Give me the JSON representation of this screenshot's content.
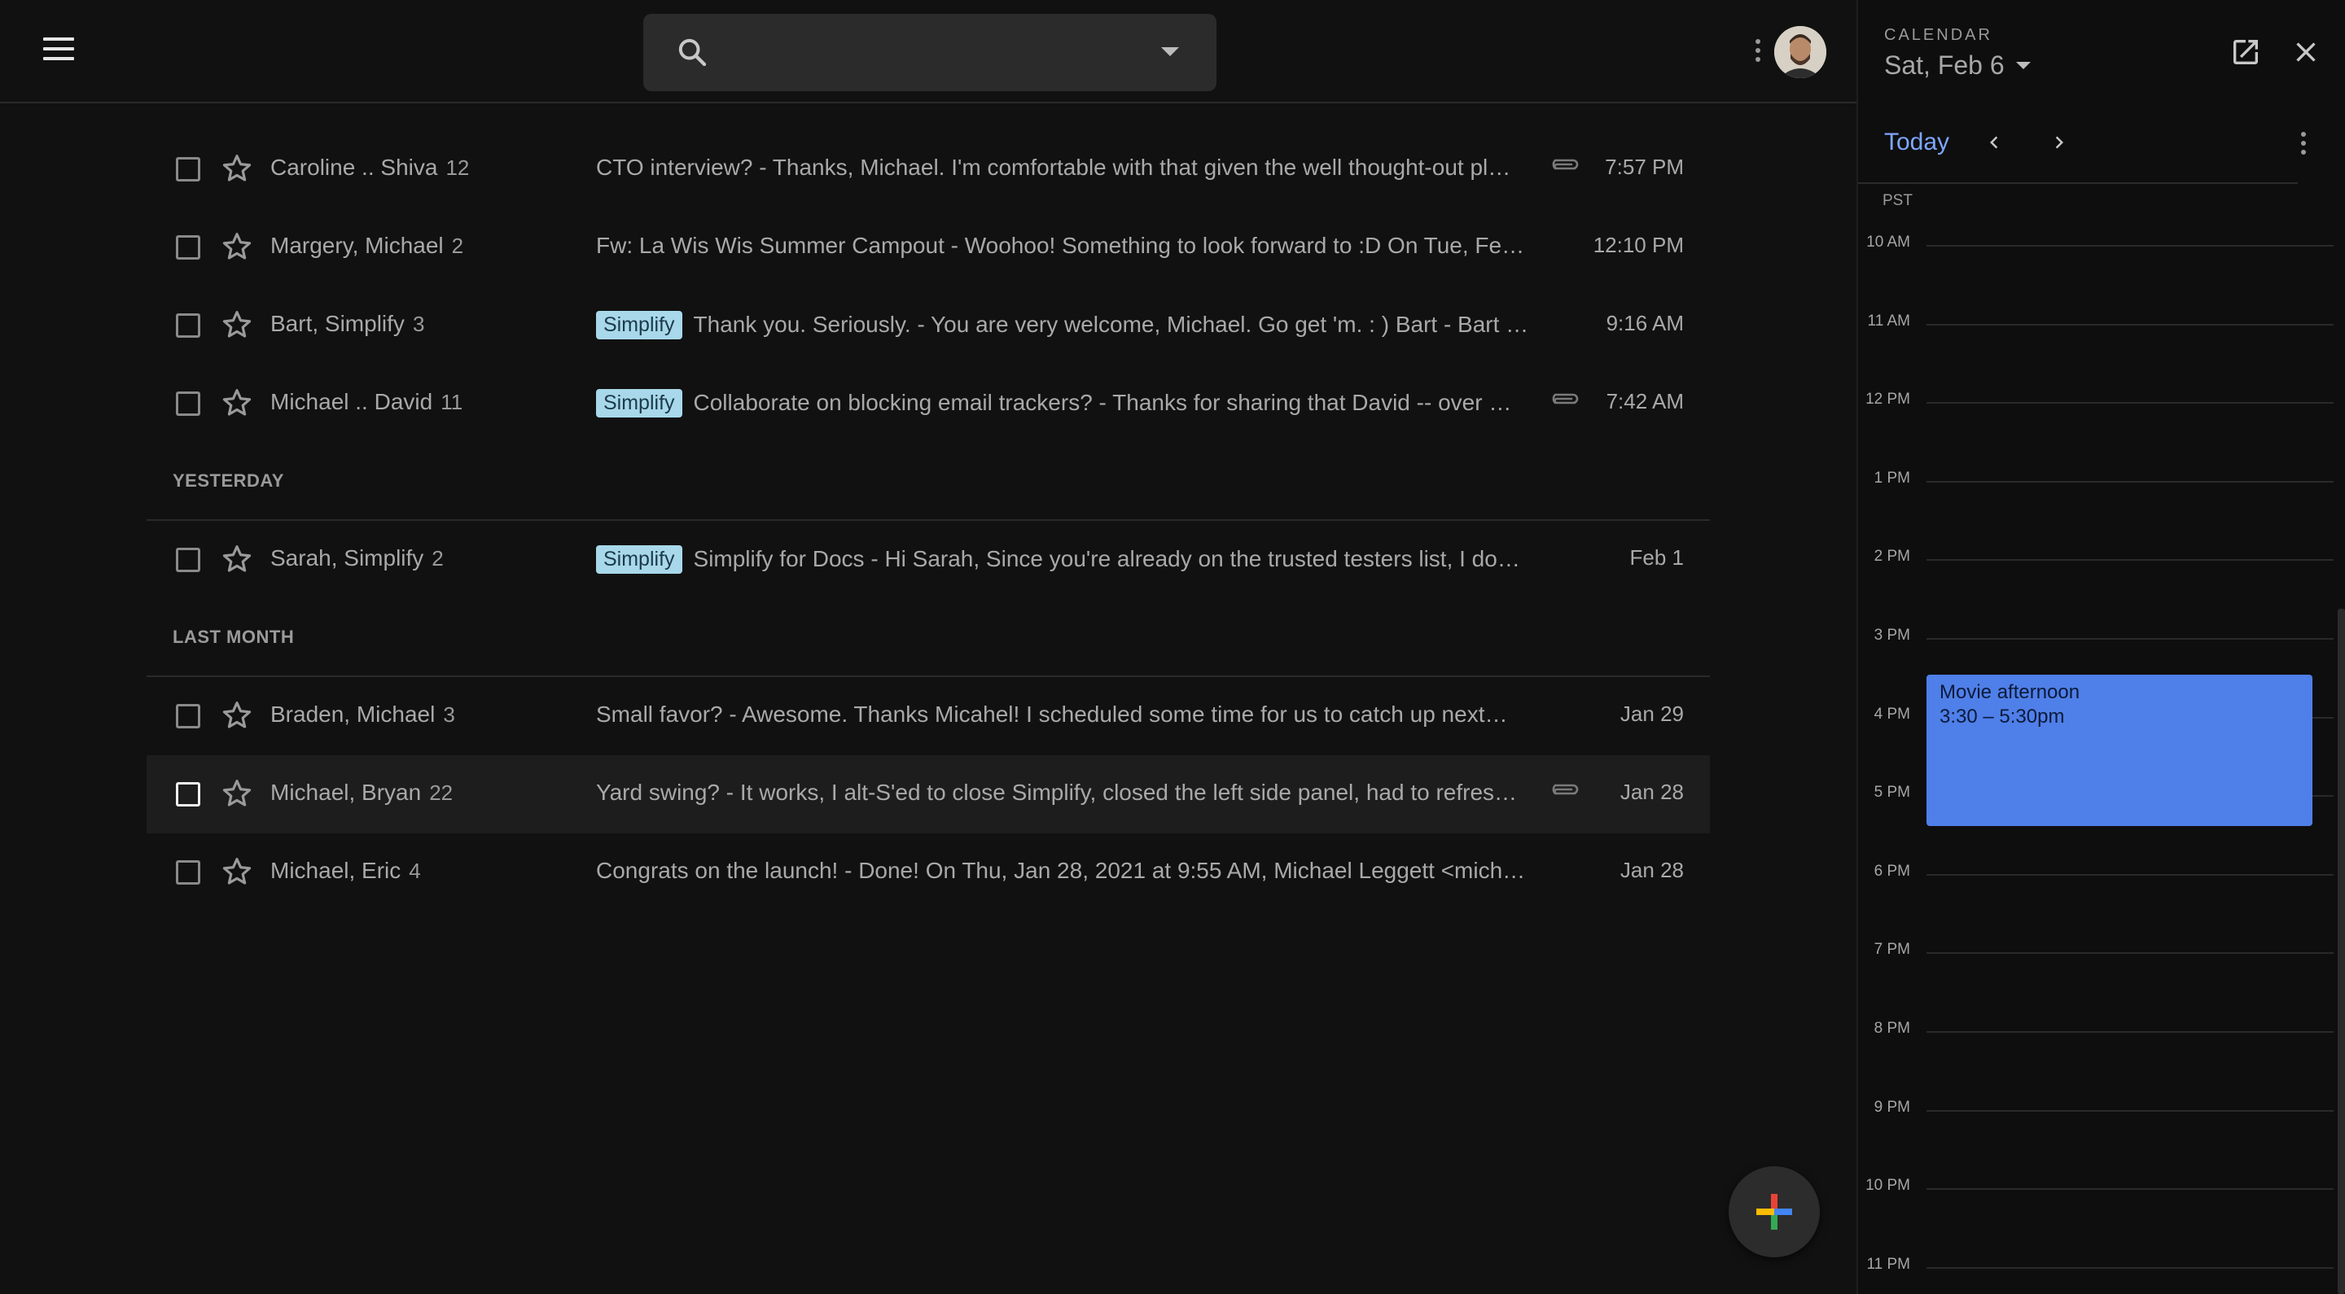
{
  "search": {
    "placeholder": "",
    "value": ""
  },
  "mail": {
    "rows": [
      {
        "sender": "Caroline .. Shiva",
        "count": "12",
        "label": "",
        "subject": "CTO interview? - Thanks, Michael. I'm comfortable with that given the well thought-out pl…",
        "attachment": true,
        "time": "7:57 PM"
      },
      {
        "sender": "Margery, Michael",
        "count": "2",
        "label": "",
        "subject": "Fw: La Wis Wis Summer Campout - Woohoo! Something to look forward to :D On Tue, Fe…",
        "attachment": false,
        "time": "12:10 PM"
      },
      {
        "sender": "Bart, Simplify",
        "count": "3",
        "label": "Simplify",
        "subject": "Thank you. Seriously. - You are very welcome, Michael. Go get 'm. : ) Bart - Bart …",
        "attachment": false,
        "time": "9:16 AM"
      },
      {
        "sender": "Michael .. David",
        "count": "11",
        "label": "Simplify",
        "subject": "Collaborate on blocking email trackers? - Thanks for sharing that David -- over …",
        "attachment": true,
        "time": "7:42 AM"
      }
    ],
    "section_yesterday": "YESTERDAY",
    "rows_yesterday": [
      {
        "sender": "Sarah, Simplify",
        "count": "2",
        "label": "Simplify",
        "subject": "Simplify for Docs - Hi Sarah, Since you're already on the trusted testers list, I do…",
        "attachment": false,
        "time": "Feb 1"
      }
    ],
    "section_last_month": "LAST MONTH",
    "rows_last_month": [
      {
        "sender": "Braden, Michael",
        "count": "3",
        "label": "",
        "subject": "Small favor? - Awesome. Thanks Micahel! I scheduled some time for us to catch up next…",
        "attachment": false,
        "time": "Jan 29"
      },
      {
        "sender": "Michael, Bryan",
        "count": "22",
        "label": "",
        "subject": "Yard swing? - It works, I alt-S'ed to close Simplify, closed the left side panel, had to refres…",
        "attachment": true,
        "time": "Jan 28"
      },
      {
        "sender": "Michael, Eric",
        "count": "4",
        "label": "",
        "subject": "Congrats on the launch! - Done! On Thu, Jan 28, 2021 at 9:55 AM, Michael Leggett <mich…",
        "attachment": false,
        "time": "Jan 28"
      }
    ]
  },
  "calendar": {
    "caption": "CALENDAR",
    "date": "Sat, Feb 6",
    "today_label": "Today",
    "timezone": "PST",
    "hours": [
      "10 AM",
      "11 AM",
      "12 PM",
      "1 PM",
      "2 PM",
      "3 PM",
      "4 PM",
      "5 PM",
      "6 PM",
      "7 PM",
      "8 PM",
      "9 PM",
      "10 PM",
      "11 PM"
    ],
    "event": {
      "title": "Movie afternoon",
      "time": "3:30 – 5:30pm",
      "color": "#4f7fe8"
    }
  },
  "colors": {
    "background": "#111111",
    "chip": "#a8d8ea",
    "accent": "#7ea6ff"
  },
  "icons": {
    "menu": "hamburger-icon",
    "search": "search-icon",
    "more": "more-vert-icon",
    "star": "star-outline-icon",
    "attachment": "paperclip-icon",
    "compose": "plus-icon",
    "open": "open-in-new-icon",
    "close": "close-icon",
    "prev": "chevron-left-icon",
    "next": "chevron-right-icon"
  }
}
